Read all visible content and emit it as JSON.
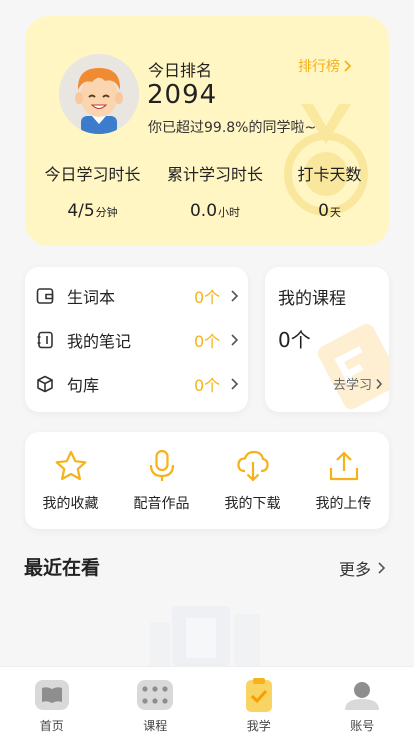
{
  "rank_card": {
    "rank_label": "今日排名",
    "rank_value": "2094",
    "rank_desc": "你已超过99.8%的同学啦~",
    "leaderboard_label": "排行榜",
    "stats": [
      {
        "label": "今日学习时长",
        "value": "4/5",
        "unit": "分钟"
      },
      {
        "label": "累计学习时长",
        "value": "0.0",
        "unit": "小时"
      },
      {
        "label": "打卡天数",
        "value": "0",
        "unit": "天"
      }
    ]
  },
  "study_list": {
    "items": [
      {
        "label": "生词本",
        "count": "0个",
        "icon": "wallet-icon"
      },
      {
        "label": "我的笔记",
        "count": "0个",
        "icon": "notebook-icon"
      },
      {
        "label": "句库",
        "count": "0个",
        "icon": "cube-icon"
      }
    ]
  },
  "courses": {
    "title": "我的课程",
    "count": "0个",
    "go_label": "去学习"
  },
  "actions": [
    {
      "label": "我的收藏",
      "icon": "star-icon"
    },
    {
      "label": "配音作品",
      "icon": "microphone-icon"
    },
    {
      "label": "我的下载",
      "icon": "cloud-download-icon"
    },
    {
      "label": "我的上传",
      "icon": "upload-icon"
    }
  ],
  "recent": {
    "title": "最近在看",
    "more_label": "更多"
  },
  "tabbar": {
    "tabs": [
      {
        "label": "首页",
        "icon": "book-open-icon",
        "active": false
      },
      {
        "label": "课程",
        "icon": "grid-icon",
        "active": false
      },
      {
        "label": "我学",
        "icon": "clipboard-check-icon",
        "active": true
      },
      {
        "label": "账号",
        "icon": "user-icon",
        "active": false
      }
    ]
  },
  "colors": {
    "accent": "#f5b21a",
    "rank_card_bg": "#fff6c4",
    "page_bg": "#f6f6f6"
  }
}
